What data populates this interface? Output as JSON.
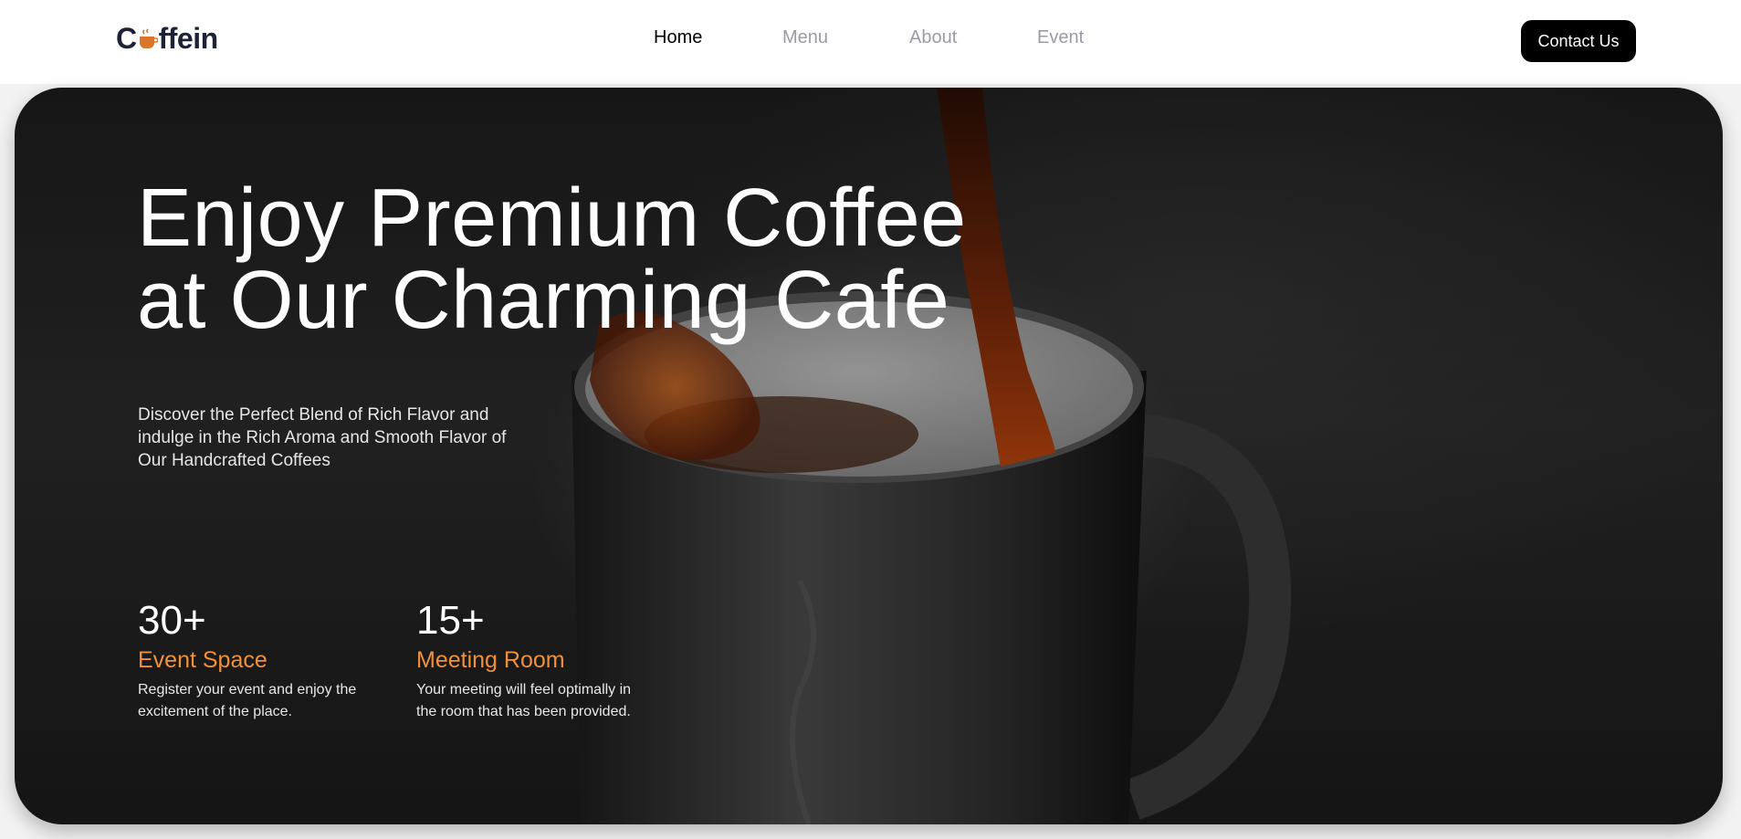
{
  "header": {
    "logo": {
      "prefix": "C",
      "suffix": "ffein",
      "icon": "coffee-cup-icon"
    },
    "nav": [
      {
        "label": "Home",
        "active": true
      },
      {
        "label": "Menu",
        "active": false
      },
      {
        "label": "About",
        "active": false
      },
      {
        "label": "Event",
        "active": false
      }
    ],
    "contact_label": "Contact Us"
  },
  "hero": {
    "title_line1": "Enjoy Premium Coffee",
    "title_line2": "at Our Charming Cafe",
    "description": "Discover the Perfect Blend of Rich Flavor and indulge in the Rich Aroma and Smooth Flavor of Our Handcrafted Coffees",
    "stats": [
      {
        "number": "30+",
        "title": "Event Space",
        "text": "Register your event and enjoy the excitement of the place."
      },
      {
        "number": "15+",
        "title": "Meeting Room",
        "text": "Your meeting will feel optimally in the room that has been provided."
      }
    ]
  },
  "colors": {
    "accent": "#f0913a",
    "button_bg": "#000000",
    "nav_inactive": "#9b9ba6",
    "logo": "#1e2235"
  }
}
